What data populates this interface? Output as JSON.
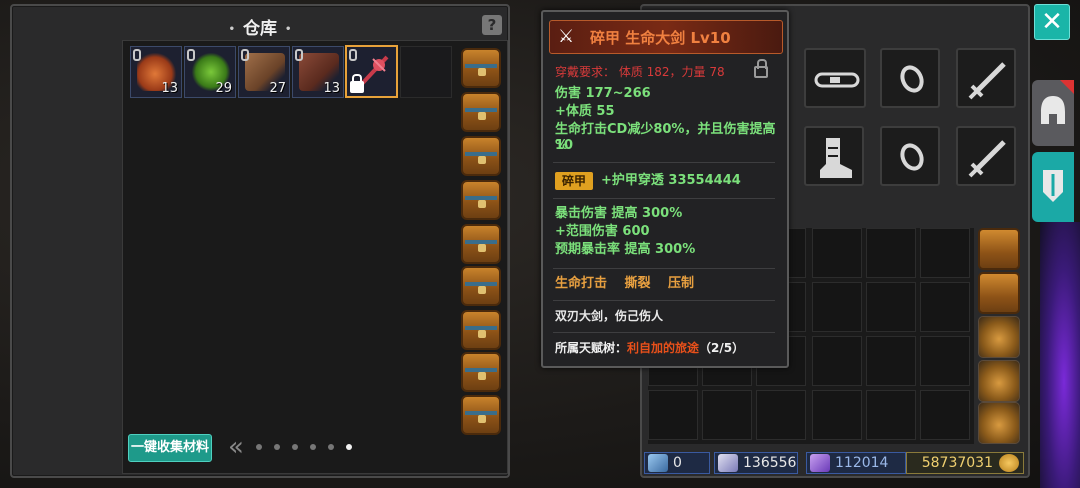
{
  "warehouse": {
    "title": "仓库",
    "help_icon": "help-icon",
    "collect_button": "一键收集材料",
    "slots": [
      {
        "name": "material-slot-1",
        "count": "13",
        "color": "#b85a2a"
      },
      {
        "name": "material-slot-2",
        "count": "29",
        "color": "#5aa02a"
      },
      {
        "name": "material-slot-3",
        "count": "27",
        "color": "#8a5a3a"
      },
      {
        "name": "material-slot-4",
        "count": "13",
        "color": "#6a3a2a"
      },
      {
        "name": "weapon-slot-selected",
        "count": "",
        "color": "#c83a4a"
      }
    ],
    "pager": {
      "back_icon": "«",
      "pages": 6,
      "active_page": 6
    }
  },
  "tooltip": {
    "name": "碎甲 生命大剑 Lv10",
    "requirement": "穿戴要求： 体质 182，力量 78",
    "damage": "伤害 177~266",
    "stat1": "+体质 55",
    "effect_line1": "生命打击CD减少80%，并且伤害提高10",
    "effect_line2": "%",
    "badge": "碎甲",
    "badge_effect": "+护甲穿透 33554444",
    "crit1": "暴击伤害 提高 300%",
    "crit2": "+范围伤害 600",
    "crit3": "预期暴击率 提高 300%",
    "skills": "生命打击　 撕裂　 压制",
    "description": "双刃大剑，伤己伤人",
    "talent_label": "所属天赋树：",
    "talent_name": "利自加的旅途",
    "talent_progress": "（2/5）"
  },
  "currency": {
    "c1": "0",
    "c2": "136556",
    "c3": "112014",
    "gold": "58737031"
  },
  "side": {
    "close": "✕"
  },
  "icons": {
    "belt": "belt-icon",
    "ring": "ring-icon",
    "sword": "sword-icon",
    "boots": "boots-icon",
    "helmet": "helmet-icon",
    "armor": "armor-icon"
  }
}
